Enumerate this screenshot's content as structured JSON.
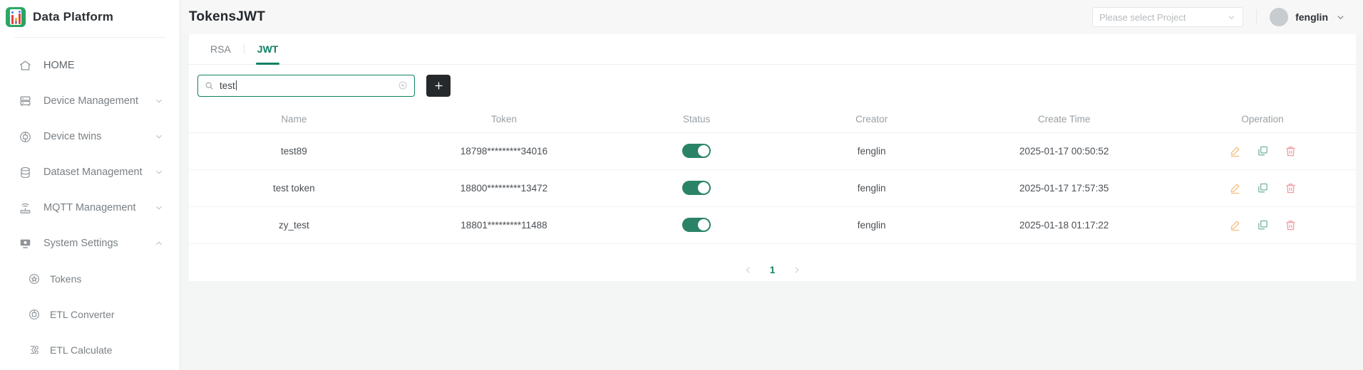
{
  "brand": {
    "name": "Data Platform",
    "logo_icon": "bar-chart-logo-icon"
  },
  "sidebar": {
    "items": [
      {
        "label": "HOME",
        "icon": "home-icon",
        "expandable": false,
        "sub": false
      },
      {
        "label": "Device Management",
        "icon": "server-rack-icon",
        "expandable": true,
        "sub": false
      },
      {
        "label": "Device twins",
        "icon": "device-twin-icon",
        "expandable": true,
        "sub": false
      },
      {
        "label": "Dataset Management",
        "icon": "database-icon",
        "expandable": true,
        "sub": false
      },
      {
        "label": "MQTT Management",
        "icon": "router-wifi-icon",
        "expandable": true,
        "sub": false
      },
      {
        "label": "System Settings",
        "icon": "monitor-settings-icon",
        "expandable": true,
        "expanded": true,
        "sub": false
      },
      {
        "label": "Tokens",
        "icon": "token-badge-icon",
        "expandable": false,
        "sub": true
      },
      {
        "label": "ETL Converter",
        "icon": "converter-icon",
        "expandable": false,
        "sub": true
      },
      {
        "label": "ETL Calculate",
        "icon": "calculate-icon",
        "expandable": false,
        "sub": true
      }
    ]
  },
  "header": {
    "title": "TokensJWT",
    "project_select": {
      "placeholder": "Please select Project",
      "icon": "chevron-down-icon"
    },
    "user": {
      "name": "fenglin",
      "avatar_icon": "avatar-icon",
      "menu_icon": "chevron-down-icon"
    }
  },
  "tabs": [
    {
      "label": "RSA",
      "active": false
    },
    {
      "label": "JWT",
      "active": true
    }
  ],
  "toolbar": {
    "search": {
      "value": "test",
      "placeholder": "",
      "icon": "search-icon",
      "clear_icon": "clear-circle-icon"
    },
    "add_button": {
      "label": "+",
      "icon": "plus-icon"
    }
  },
  "table": {
    "columns": [
      "Name",
      "Token",
      "Status",
      "Creator",
      "Create Time",
      "Operation"
    ],
    "rows": [
      {
        "name": "test89",
        "token": "18798*********34016",
        "status_on": true,
        "creator": "fenglin",
        "create_time": "2025-01-17 00:50:52",
        "operations": [
          "edit-icon",
          "copy-icon",
          "delete-icon"
        ]
      },
      {
        "name": "test token",
        "token": "18800*********13472",
        "status_on": true,
        "creator": "fenglin",
        "create_time": "2025-01-17 17:57:35",
        "operations": [
          "edit-icon",
          "copy-icon",
          "delete-icon"
        ]
      },
      {
        "name": "zy_test",
        "token": "18801*********11488",
        "status_on": true,
        "creator": "fenglin",
        "create_time": "2025-01-18 01:17:22",
        "operations": [
          "edit-icon",
          "copy-icon",
          "delete-icon"
        ]
      }
    ]
  },
  "pagination": {
    "prev_icon": "chevron-left-icon",
    "next_icon": "chevron-right-icon",
    "pages": [
      "1"
    ],
    "current": "1"
  },
  "colors": {
    "accent_green": "#0f8063",
    "toggle_on": "#2b8367",
    "edit_icon": "#f5c084",
    "copy_icon": "#7cb7a5",
    "delete_icon": "#f0a0a6",
    "page_bg": "#f4f5f5"
  }
}
